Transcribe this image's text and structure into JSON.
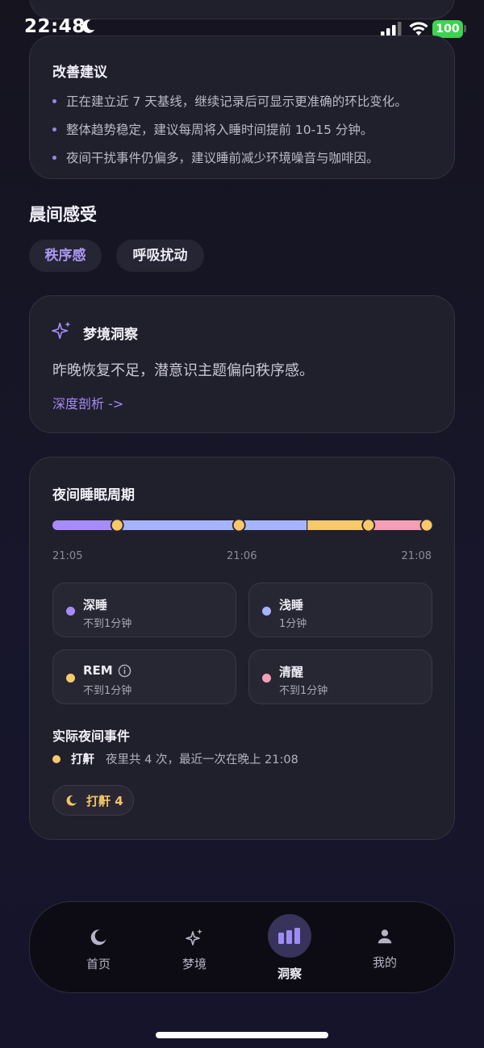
{
  "status_bar": {
    "time": "22:48",
    "battery": "100"
  },
  "suggestions": {
    "title": "改善建议",
    "items": [
      "正在建立近 7 天基线，继续记录后可显示更准确的环比变化。",
      "整体趋势稳定，建议每周将入睡时间提前 10-15 分钟。",
      "夜间干扰事件仍偏多，建议睡前减少环境噪音与咖啡因。"
    ]
  },
  "morning": {
    "title": "晨间感受",
    "tags": [
      "秩序感",
      "呼吸扰动"
    ]
  },
  "dream_insight": {
    "title": "梦境洞察",
    "body": "昨晚恢复不足，潜意识主题偏向秩序感。",
    "link": "深度剖析 ->"
  },
  "sleep_cycle": {
    "title": "夜间睡眠周期",
    "time_labels": [
      "21:05",
      "21:06",
      "21:08"
    ],
    "segments": [
      {
        "stage": "deep",
        "start": 0.0,
        "end": 0.17,
        "color": "#a78bfa"
      },
      {
        "stage": "light",
        "start": 0.17,
        "end": 0.67,
        "color": "#a5b4fc"
      },
      {
        "stage": "rem",
        "start": 0.67,
        "end": 0.83,
        "color": "#f7c96a"
      },
      {
        "stage": "awake",
        "start": 0.83,
        "end": 1.0,
        "color": "#f59eb5"
      }
    ],
    "event_markers": [
      0.17,
      0.49,
      0.83,
      0.99
    ],
    "legend": [
      {
        "name": "深睡",
        "value": "不到1分钟",
        "color": "#a78bfa"
      },
      {
        "name": "浅睡",
        "value": "1分钟",
        "color": "#a5b4fc"
      },
      {
        "name": "REM",
        "value": "不到1分钟",
        "color": "#f7c96a"
      },
      {
        "name": "清醒",
        "value": "不到1分钟",
        "color": "#f59eb5"
      }
    ],
    "events_title": "实际夜间事件",
    "event": {
      "name": "打鼾",
      "desc": "夜里共 4 次，最近一次在晚上 21:08"
    },
    "event_chip": "打鼾 4"
  },
  "nav": {
    "items": [
      {
        "label": "首页",
        "icon": "moon-icon"
      },
      {
        "label": "梦境",
        "icon": "sparkle-icon"
      },
      {
        "label": "洞察",
        "icon": "bar-chart-icon"
      },
      {
        "label": "我的",
        "icon": "user-icon"
      }
    ],
    "active_index": 2
  },
  "colors": {
    "accent": "#9b87e8",
    "deep": "#a78bfa",
    "light": "#a5b4fc",
    "rem": "#f7c96a",
    "awake": "#f59eb5"
  }
}
